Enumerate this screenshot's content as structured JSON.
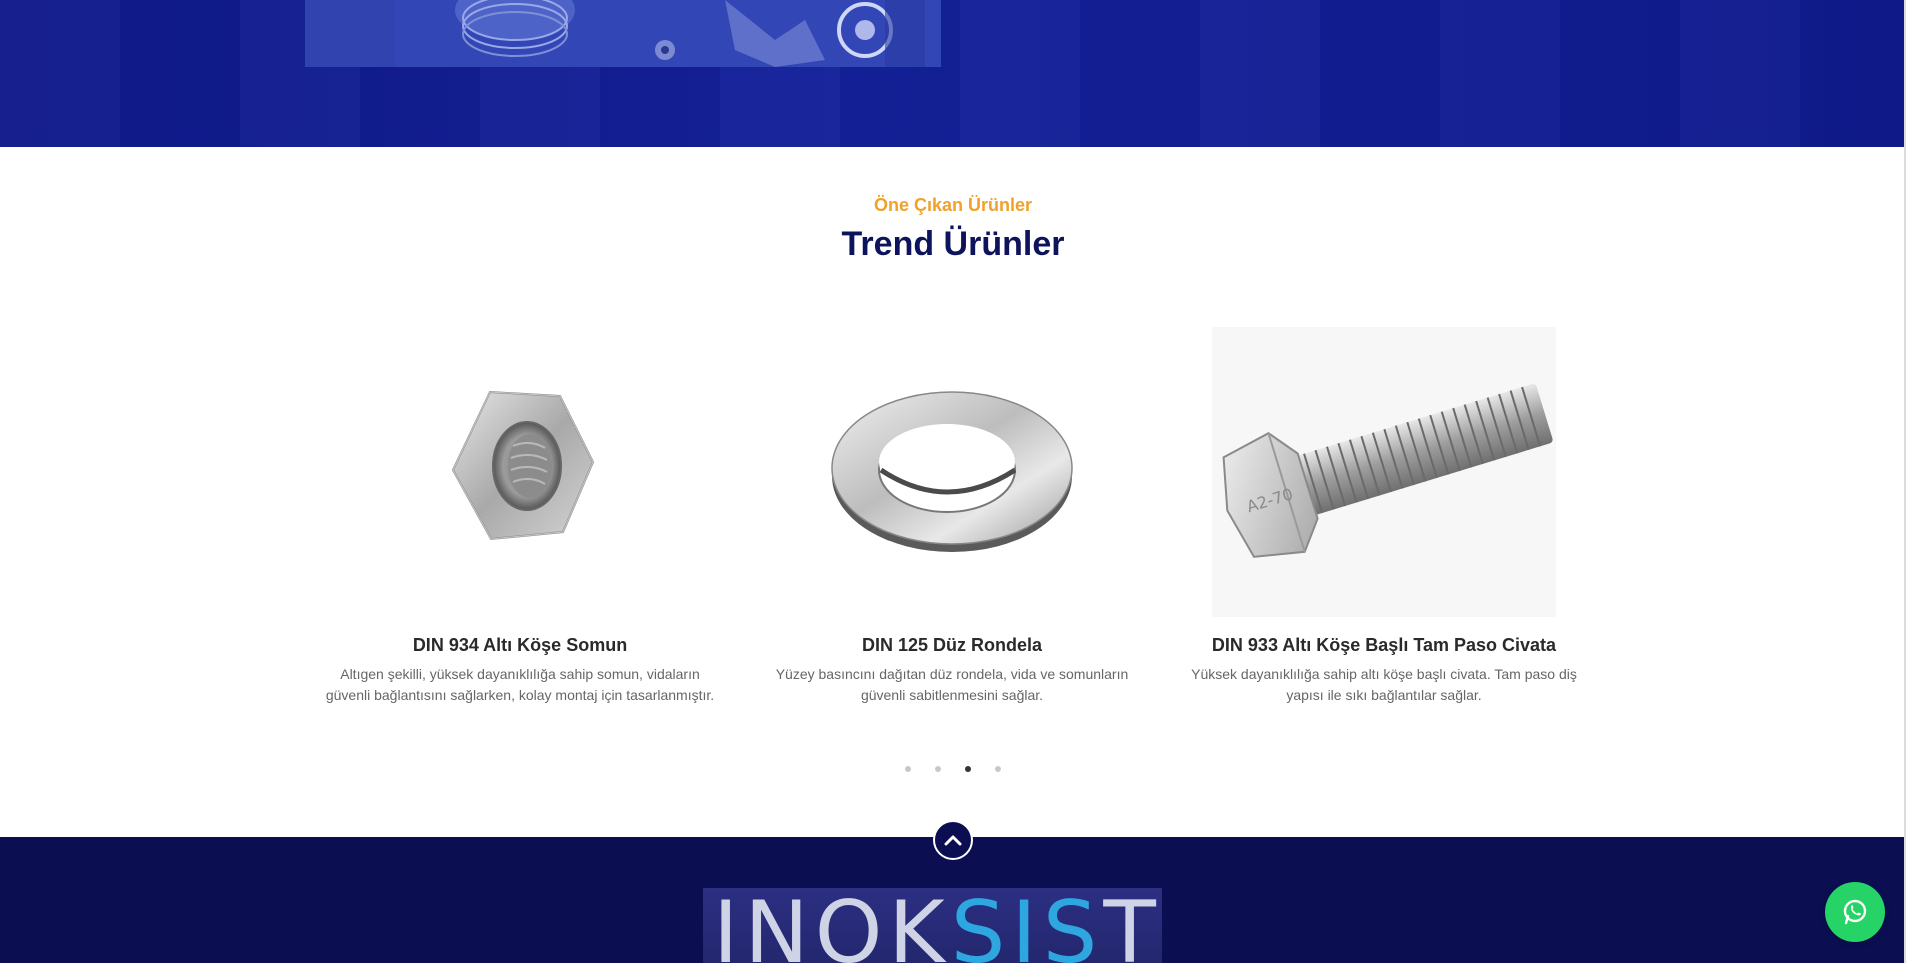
{
  "section": {
    "eyebrow": "Öne Çıkan Ürünler",
    "title": "Trend Ürünler"
  },
  "products": [
    {
      "name": "DIN 934 Altı Köşe Somun",
      "description": "Altıgen şekilli, yüksek dayanıklılığa sahip somun, vidaların güvenli bağlantısını sağlarken, kolay montaj için tasarlanmıştır.",
      "icon": "hex-nut-image"
    },
    {
      "name": "DIN 125 Düz Rondela",
      "description": "Yüzey basıncını dağıtan düz rondela, vida ve somunların güvenli sabitlenmesini sağlar.",
      "icon": "flat-washer-image"
    },
    {
      "name": "DIN 933 Altı Köşe Başlı Tam Paso Civata",
      "description": "Yüksek dayanıklılığa sahip altı köşe başlı civata. Tam paso diş yapısı ile sıkı bağlantılar sağlar.",
      "icon": "hex-bolt-image"
    }
  ],
  "carousel": {
    "dot_count": 4,
    "active_index": 2
  },
  "footer": {
    "logo_part1": "INOK",
    "logo_part2": "SIS",
    "logo_part3": "T"
  },
  "colors": {
    "accent": "#f0a12a",
    "title": "#0d145c",
    "footer": "#0b0f52",
    "whatsapp": "#25d366"
  }
}
